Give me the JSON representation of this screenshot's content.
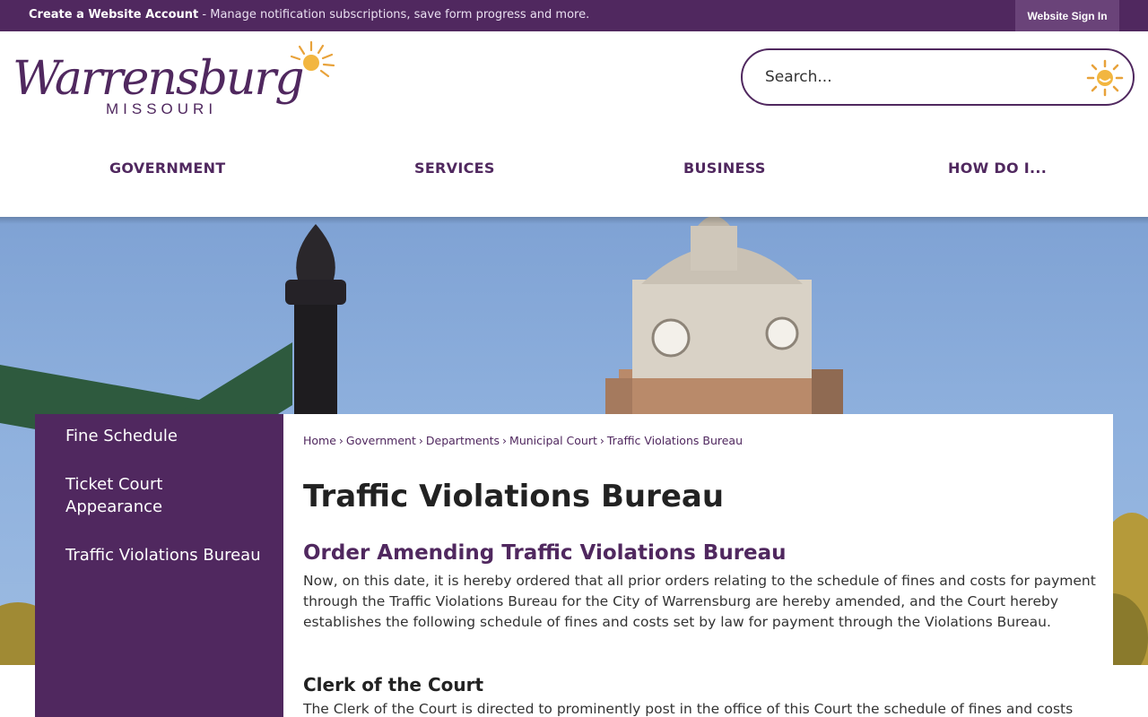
{
  "topbar": {
    "create_account_label": "Create a Website Account",
    "create_account_rest": " - Manage notification subscriptions, save form progress and more.",
    "signin_label": "Website Sign In",
    "color": "#50285f"
  },
  "header": {
    "logo_text": "Warrensburg",
    "logo_subtext": "MISSOURI",
    "search_placeholder": "Search..."
  },
  "nav": {
    "items": [
      {
        "label": "GOVERNMENT"
      },
      {
        "label": "SERVICES"
      },
      {
        "label": "BUSINESS"
      },
      {
        "label": "HOW DO I..."
      }
    ]
  },
  "sidebar": {
    "items": [
      {
        "label": "Fine Schedule"
      },
      {
        "label": "Ticket Court Appearance"
      },
      {
        "label": "Traffic Violations Bureau"
      }
    ]
  },
  "breadcrumb": {
    "items": [
      "Home",
      "Government",
      "Departments",
      "Municipal Court"
    ],
    "current": "Traffic Violations Bureau"
  },
  "page": {
    "title": "Traffic Violations Bureau",
    "section_title": "Order Amending Traffic Violations Bureau",
    "section_body": "Now, on this date, it is hereby ordered that all prior orders relating to the schedule of fines and costs for payment through the Traffic Violations Bureau for the City of Warrensburg are hereby amended, and the Court hereby establishes the following schedule of fines and costs set by law for payment through the Violations Bureau.",
    "subsection_title": "Clerk of the Court",
    "subsection_body": "The Clerk of the Court is directed to prominently post in the office of this Court the schedule of fines and costs"
  },
  "colors": {
    "brand_purple": "#50285f",
    "accent_orange": "#e8a23a"
  }
}
